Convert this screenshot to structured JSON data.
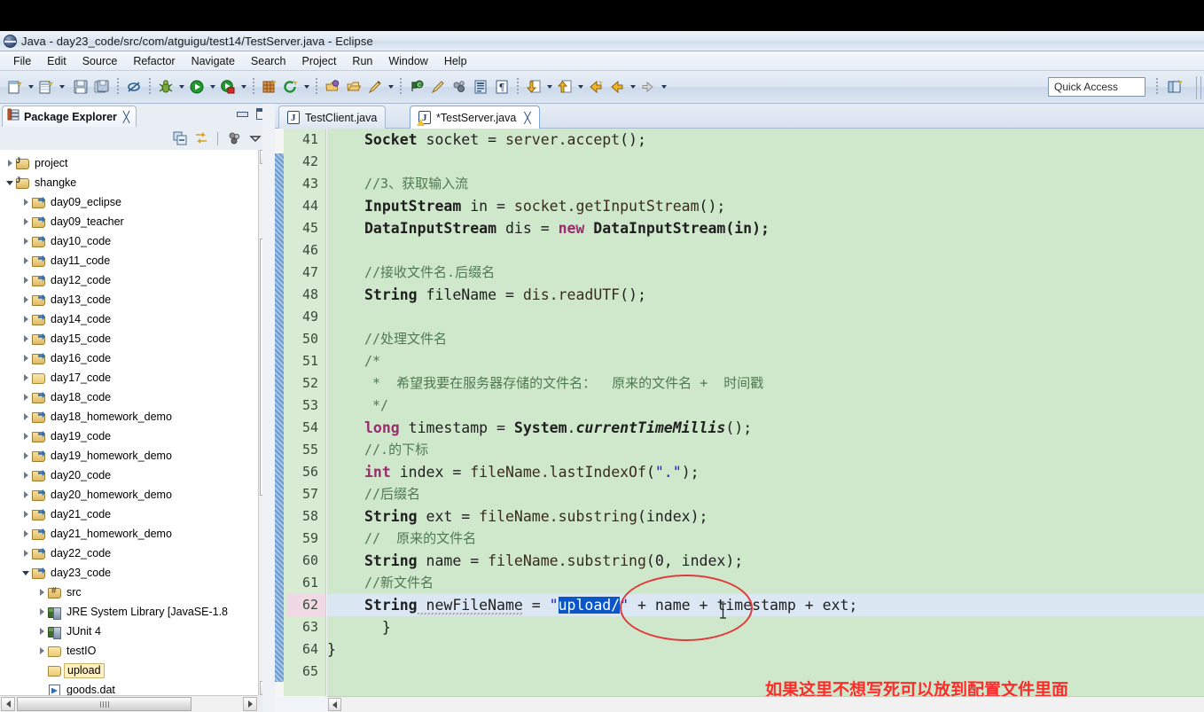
{
  "window": {
    "title": "Java - day23_code/src/com/atguigu/test14/TestServer.java - Eclipse",
    "app_icon": "eclipse-icon"
  },
  "menubar": {
    "items": [
      "File",
      "Edit",
      "Source",
      "Refactor",
      "Navigate",
      "Search",
      "Project",
      "Run",
      "Window",
      "Help"
    ]
  },
  "toolbar": {
    "quick_access_placeholder": "Quick Access",
    "icons": [
      "new-wizard-icon",
      "new-java-class-icon",
      "save-icon",
      "save-all-icon",
      "skip-breakpoints-icon",
      "debug-icon",
      "run-icon",
      "run-coverage-icon",
      "new-package-icon",
      "open-type-icon",
      "open-task-icon",
      "open-folder-icon",
      "edit-icon",
      "search-icon",
      "mark-occurrences-icon",
      "link-icon",
      "toggle-block-selection-icon",
      "show-whitespace-icon",
      "next-annotation-icon",
      "previous-annotation-icon",
      "last-edit-location-icon",
      "back-icon",
      "forward-icon",
      "open-perspective-icon"
    ]
  },
  "package_explorer": {
    "tab_label": "Package Explorer",
    "close_label": "╳",
    "toolbar_icons": [
      "collapse-all-icon",
      "link-with-editor-icon",
      "view-menu-filters-icon",
      "view-menu-icon"
    ],
    "tree": [
      {
        "label": "project",
        "indent": 0,
        "twisty": "closed",
        "icon": "package-root-icon",
        "selected": false
      },
      {
        "label": "shangke",
        "indent": 0,
        "twisty": "open",
        "icon": "package-root-icon",
        "selected": false
      },
      {
        "label": "day09_eclipse",
        "indent": 1,
        "twisty": "closed",
        "icon": "java-project-icon",
        "selected": false
      },
      {
        "label": "day09_teacher",
        "indent": 1,
        "twisty": "closed",
        "icon": "java-project-icon",
        "selected": false
      },
      {
        "label": "day10_code",
        "indent": 1,
        "twisty": "closed",
        "icon": "java-project-icon",
        "selected": false
      },
      {
        "label": "day11_code",
        "indent": 1,
        "twisty": "closed",
        "icon": "java-project-icon",
        "selected": false
      },
      {
        "label": "day12_code",
        "indent": 1,
        "twisty": "closed",
        "icon": "java-project-icon",
        "selected": false
      },
      {
        "label": "day13_code",
        "indent": 1,
        "twisty": "closed",
        "icon": "java-project-icon",
        "selected": false
      },
      {
        "label": "day14_code",
        "indent": 1,
        "twisty": "closed",
        "icon": "java-project-icon",
        "selected": false
      },
      {
        "label": "day15_code",
        "indent": 1,
        "twisty": "closed",
        "icon": "java-project-icon",
        "selected": false
      },
      {
        "label": "day16_code",
        "indent": 1,
        "twisty": "closed",
        "icon": "java-project-icon",
        "selected": false
      },
      {
        "label": "day17_code",
        "indent": 1,
        "twisty": "closed",
        "icon": "closed-project-icon",
        "selected": false
      },
      {
        "label": "day18_code",
        "indent": 1,
        "twisty": "closed",
        "icon": "java-project-icon",
        "selected": false
      },
      {
        "label": "day18_homework_demo",
        "indent": 1,
        "twisty": "closed",
        "icon": "java-project-icon",
        "selected": false
      },
      {
        "label": "day19_code",
        "indent": 1,
        "twisty": "closed",
        "icon": "java-project-icon",
        "selected": false
      },
      {
        "label": "day19_homework_demo",
        "indent": 1,
        "twisty": "closed",
        "icon": "java-project-icon",
        "selected": false
      },
      {
        "label": "day20_code",
        "indent": 1,
        "twisty": "closed",
        "icon": "java-project-icon",
        "selected": false
      },
      {
        "label": "day20_homework_demo",
        "indent": 1,
        "twisty": "closed",
        "icon": "java-project-icon",
        "selected": false
      },
      {
        "label": "day21_code",
        "indent": 1,
        "twisty": "closed",
        "icon": "java-project-icon",
        "selected": false
      },
      {
        "label": "day21_homework_demo",
        "indent": 1,
        "twisty": "closed",
        "icon": "java-project-icon",
        "selected": false
      },
      {
        "label": "day22_code",
        "indent": 1,
        "twisty": "closed",
        "icon": "java-project-icon",
        "selected": false
      },
      {
        "label": "day23_code",
        "indent": 1,
        "twisty": "open",
        "icon": "java-project-icon",
        "selected": false
      },
      {
        "label": "src",
        "indent": 2,
        "twisty": "closed",
        "icon": "source-folder-icon",
        "selected": false
      },
      {
        "label": "JRE System Library [JavaSE-1.8",
        "indent": 2,
        "twisty": "closed",
        "icon": "library-icon",
        "selected": false
      },
      {
        "label": "JUnit 4",
        "indent": 2,
        "twisty": "closed",
        "icon": "library-icon",
        "selected": false
      },
      {
        "label": "testIO",
        "indent": 2,
        "twisty": "closed",
        "icon": "folder-icon",
        "selected": false
      },
      {
        "label": "upload",
        "indent": 2,
        "twisty": "none",
        "icon": "folder-icon",
        "selected": true
      },
      {
        "label": "goods.dat",
        "indent": 2,
        "twisty": "none",
        "icon": "file-icon",
        "selected": false
      }
    ]
  },
  "editor": {
    "tabs": [
      {
        "label": "TestClient.java",
        "active": false,
        "dirty": false,
        "warning": false,
        "close": "╳"
      },
      {
        "label": "*TestServer.java",
        "active": true,
        "dirty": true,
        "warning": true,
        "close": "╳"
      }
    ],
    "first_line": 41,
    "last_line": 65,
    "marked_line": 62,
    "highlighted_line": 62,
    "line_numbers": [
      "41",
      "42",
      "43",
      "44",
      "45",
      "46",
      "47",
      "48",
      "49",
      "50",
      "51",
      "52",
      "53",
      "54",
      "55",
      "56",
      "57",
      "58",
      "59",
      "60",
      "61",
      "62",
      "63",
      "64",
      "65"
    ],
    "lines": [
      {
        "n": "41",
        "text": "    Socket socket = server.accept();"
      },
      {
        "n": "42",
        "text": ""
      },
      {
        "n": "43",
        "text": "    //3、获取输入流"
      },
      {
        "n": "44",
        "text": "    InputStream in = socket.getInputStream();"
      },
      {
        "n": "45",
        "text": "    DataInputStream dis = new DataInputStream(in);"
      },
      {
        "n": "46",
        "text": ""
      },
      {
        "n": "47",
        "text": "    //接收文件名.后缀名"
      },
      {
        "n": "48",
        "text": "    String fileName = dis.readUTF();"
      },
      {
        "n": "49",
        "text": ""
      },
      {
        "n": "50",
        "text": "    //处理文件名"
      },
      {
        "n": "51",
        "text": "    /*"
      },
      {
        "n": "52",
        "text": "     *  希望我要在服务器存储的文件名： 原来的文件名 + 时间戳"
      },
      {
        "n": "53",
        "text": "     */"
      },
      {
        "n": "54",
        "text": "    long timestamp = System.currentTimeMillis();"
      },
      {
        "n": "55",
        "text": "    //.的下标"
      },
      {
        "n": "56",
        "text": "    int index = fileName.lastIndexOf(\".\");"
      },
      {
        "n": "57",
        "text": "    //后缀名"
      },
      {
        "n": "58",
        "text": "    String ext = fileName.substring(index);"
      },
      {
        "n": "59",
        "text": "    // 原来的文件名"
      },
      {
        "n": "60",
        "text": "    String name = fileName.substring(0, index);"
      },
      {
        "n": "61",
        "text": "    //新文件名"
      },
      {
        "n": "62",
        "text": "    String newFileName = \"upload/\" + name + timestamp + ext;"
      },
      {
        "n": "63",
        "text": "  }"
      },
      {
        "n": "64",
        "text": "}"
      },
      {
        "n": "65",
        "text": ""
      }
    ],
    "tokens": {
      "l41_t1": "Socket",
      "l41_t2": " socket ",
      "l41_t3": "= ",
      "l41_t4": "server",
      "l41_t5": ".",
      "l41_t6": "accept",
      "l41_t7": "();",
      "l43_c": "//3、获取输入流",
      "l44_t1": "InputStream",
      "l44_t2": " in ",
      "l44_t3": "= ",
      "l44_t4": "socket",
      "l44_t5": ".",
      "l44_t6": "getInputStream",
      "l44_t7": "();",
      "l45_t1": "DataInputStream",
      "l45_t2": " dis ",
      "l45_t3": "= ",
      "l45_t4": "new",
      "l45_t5": " DataInputStream(in);",
      "l47_c": "//接收文件名.后缀名",
      "l48_t1": "String",
      "l48_t2": " fileName ",
      "l48_t3": "= ",
      "l48_t4": "dis",
      "l48_t5": ".",
      "l48_t6": "readUTF",
      "l48_t7": "();",
      "l50_c": "//处理文件名",
      "l51_c": "/*",
      "l52_c": " *  希望我要在服务器存储的文件名：  原来的文件名 +  时间戳",
      "l53_c": " */",
      "l54_t1": "long",
      "l54_t2": " timestamp ",
      "l54_t3": "= ",
      "l54_t4": "System",
      "l54_t5": ".",
      "l54_t6": "currentTimeMillis",
      "l54_t7": "();",
      "l55_c": "//.的下标",
      "l56_t1": "int",
      "l56_t2": " index ",
      "l56_t3": "= ",
      "l56_t4": "fileName",
      "l56_t5": ".",
      "l56_t6": "lastIndexOf",
      "l56_t7": "(",
      "l56_t8": "\".\"",
      "l56_t9": ");",
      "l57_c": "//后缀名",
      "l58_t1": "String",
      "l58_t2": " ext ",
      "l58_t3": "= ",
      "l58_t4": "fileName",
      "l58_t5": ".",
      "l58_t6": "substring",
      "l58_t7": "(index);",
      "l59_c": "//  原来的文件名",
      "l60_t1": "String",
      "l60_t2": " name ",
      "l60_t3": "= ",
      "l60_t4": "fileName",
      "l60_t5": ".",
      "l60_t6": "substring",
      "l60_t7": "(",
      "l60_t8": "0",
      "l60_t9": ", index);",
      "l61_c": "//新文件名",
      "l62_t1": "String",
      "l62_t2": " newFileName",
      "l62_t3": " = ",
      "l62_t4": "\"",
      "l62_t5": "upload/",
      "l62_t6": "\"",
      "l62_t7": " + name + timestamp + ext;",
      "l63_t": "  }",
      "l64_t": "}"
    },
    "selection": {
      "text": "upload/",
      "line": 62
    },
    "annotations": {
      "circle_target": "upload/",
      "note_text": "如果这里不想写死可以放到配置文件里面",
      "note_color": "#ff2b2b",
      "circle_color": "#e03a3a"
    }
  },
  "colors": {
    "editor_background": "#cfe8cb",
    "line_number_background": "#d8ecd4",
    "selection_background": "#0a55c8",
    "current_line_background": "#dbe7f3",
    "comment_color": "#4e7a52",
    "keyword_color": "#9b2d6f",
    "string_color": "#2020d0"
  }
}
